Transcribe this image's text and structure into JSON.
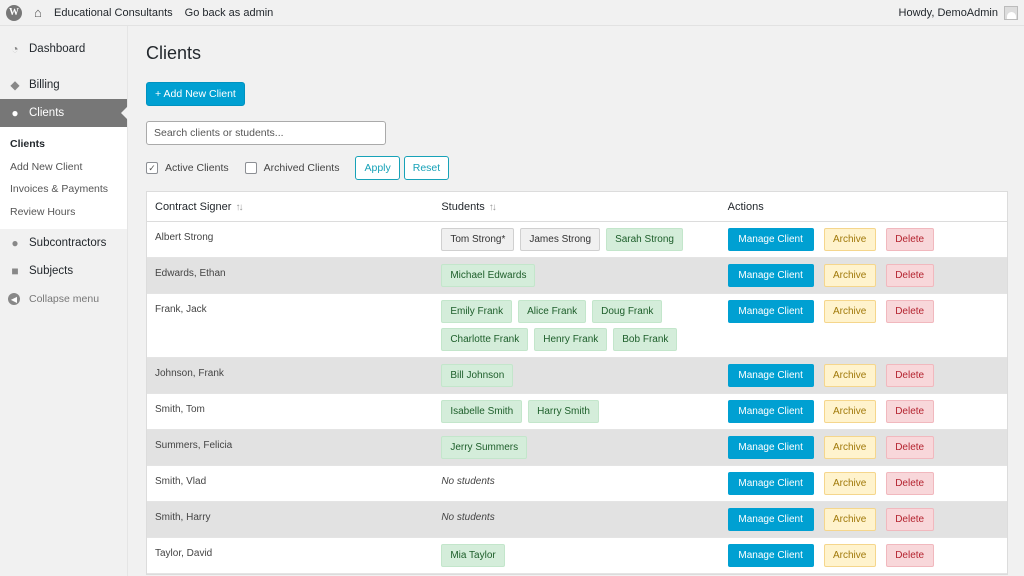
{
  "adminbar": {
    "site_name": "Educational Consultants",
    "go_back": "Go back as admin",
    "howdy": "Howdy, DemoAdmin"
  },
  "sidebar": {
    "items": [
      {
        "label": "Dashboard",
        "icon": "dashboard-icon"
      },
      {
        "label": "Billing",
        "icon": "tag-icon"
      },
      {
        "label": "Clients",
        "icon": "users-icon",
        "active": true
      }
    ],
    "submenu": [
      "Clients",
      "Add New Client",
      "Invoices & Payments",
      "Review Hours"
    ],
    "after_items": [
      {
        "label": "Subcontractors",
        "icon": "user-icon"
      },
      {
        "label": "Subjects",
        "icon": "book-icon"
      }
    ],
    "collapse": "Collapse menu"
  },
  "page": {
    "title": "Clients",
    "add_button": "+ Add New Client",
    "search_placeholder": "Search clients or students...",
    "filters": {
      "active_label": "Active Clients",
      "active_checked": true,
      "archived_label": "Archived Clients",
      "archived_checked": false,
      "apply": "Apply",
      "reset": "Reset"
    }
  },
  "table": {
    "headers": [
      "Contract Signer",
      "Students",
      "Actions"
    ],
    "actions": {
      "manage": "Manage Client",
      "archive": "Archive",
      "delete": "Delete"
    },
    "no_students": "No students",
    "rows": [
      {
        "signer": "Albert Strong",
        "students": [
          {
            "name": "Tom Strong*",
            "style": "gray"
          },
          {
            "name": "James Strong",
            "style": "gray"
          },
          {
            "name": "Sarah Strong",
            "style": "green"
          }
        ]
      },
      {
        "signer": "Edwards, Ethan",
        "students": [
          {
            "name": "Michael Edwards",
            "style": "green"
          }
        ]
      },
      {
        "signer": "Frank, Jack",
        "students": [
          {
            "name": "Emily Frank",
            "style": "green"
          },
          {
            "name": "Alice Frank",
            "style": "green"
          },
          {
            "name": "Doug Frank",
            "style": "green"
          },
          {
            "name": "Charlotte Frank",
            "style": "green"
          },
          {
            "name": "Henry Frank",
            "style": "green"
          },
          {
            "name": "Bob Frank",
            "style": "green"
          }
        ]
      },
      {
        "signer": "Johnson, Frank",
        "students": [
          {
            "name": "Bill Johnson",
            "style": "green"
          }
        ]
      },
      {
        "signer": "Smith, Tom",
        "students": [
          {
            "name": "Isabelle Smith",
            "style": "green"
          },
          {
            "name": "Harry Smith",
            "style": "green"
          }
        ]
      },
      {
        "signer": "Summers, Felicia",
        "students": [
          {
            "name": "Jerry Summers",
            "style": "green"
          }
        ]
      },
      {
        "signer": "Smith, Vlad",
        "students": []
      },
      {
        "signer": "Smith, Harry",
        "students": []
      },
      {
        "signer": "Taylor, David",
        "students": [
          {
            "name": "Mia Taylor",
            "style": "green"
          }
        ]
      }
    ]
  }
}
